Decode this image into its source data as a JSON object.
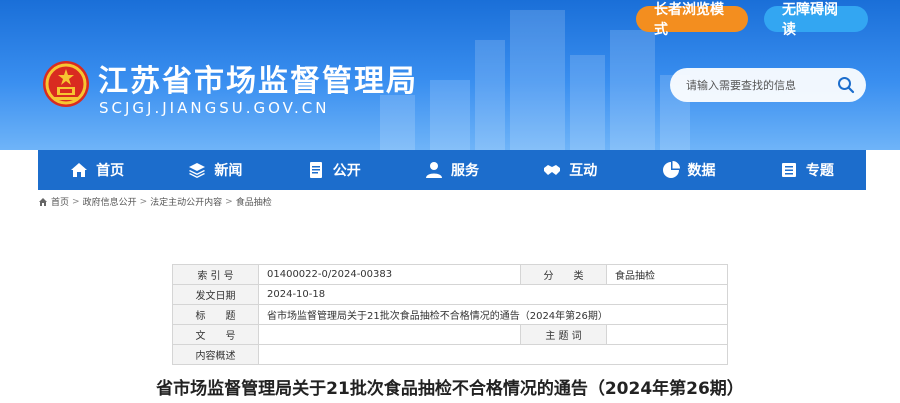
{
  "top_buttons": {
    "elder_mode": "长者浏览模式",
    "accessible": "无障碍阅读"
  },
  "site": {
    "title": "江苏省市场监督管理局",
    "domain": "SCJGJ.JIANGSU.GOV.CN"
  },
  "search": {
    "placeholder": "请输入需要查找的信息"
  },
  "nav": {
    "items": [
      {
        "label": "首页",
        "icon": "home-icon"
      },
      {
        "label": "新闻",
        "icon": "layers-icon"
      },
      {
        "label": "公开",
        "icon": "document-icon"
      },
      {
        "label": "服务",
        "icon": "user-icon"
      },
      {
        "label": "互动",
        "icon": "handshake-icon"
      },
      {
        "label": "数据",
        "icon": "pie-chart-icon"
      },
      {
        "label": "专题",
        "icon": "list-icon"
      }
    ]
  },
  "breadcrumb": {
    "items": [
      "首页",
      "政府信息公开",
      "法定主动公开内容",
      "食品抽检"
    ],
    "separator": ">"
  },
  "info_table": {
    "index_label": "索 引 号",
    "index_value": "01400022-0/2024-00383",
    "category_label": "分　　类",
    "category_value": "食品抽检",
    "date_label": "发文日期",
    "date_value": "2024-10-18",
    "title_label": "标　　题",
    "title_value": "省市场监督管理局关于21批次食品抽检不合格情况的通告（2024年第26期）",
    "docno_label": "文　　号",
    "docno_value": "",
    "subject_label": "主 题 词",
    "subject_value": "",
    "summary_label": "内容概述",
    "summary_value": ""
  },
  "article": {
    "title": "省市场监督管理局关于21批次食品抽检不合格情况的通告（2024年第26期）"
  },
  "colors": {
    "header_blue": "#1a6fd8",
    "nav_blue": "#1c6dcc",
    "elder_orange": "#f38e1f",
    "access_blue": "#33a6f2"
  }
}
